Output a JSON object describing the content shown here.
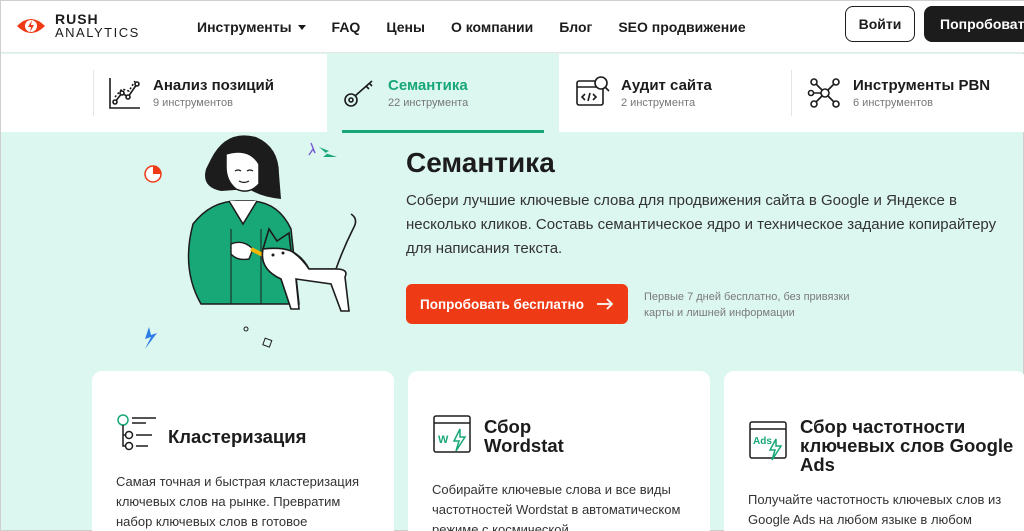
{
  "header": {
    "logo_line1": "RUSH",
    "logo_line2": "ANALYTICS",
    "nav": [
      {
        "label": "Инструменты",
        "has_dropdown": true
      },
      {
        "label": "FAQ"
      },
      {
        "label": "Цены"
      },
      {
        "label": "О компании"
      },
      {
        "label": "Блог"
      },
      {
        "label": "SEO продвижение"
      }
    ],
    "login_label": "Войти",
    "try_label": "Попробовать"
  },
  "tabs": [
    {
      "title": "Анализ позиций",
      "subtitle": "9 инструментов",
      "icon": "chart-line-icon",
      "active": false
    },
    {
      "title": "Семантика",
      "subtitle": "22 инструмента",
      "icon": "key-icon",
      "active": true
    },
    {
      "title": "Аудит сайта",
      "subtitle": "2 инструмента",
      "icon": "site-audit-icon",
      "active": false
    },
    {
      "title": "Инструменты PBN",
      "subtitle": "6 инструментов",
      "icon": "network-icon",
      "active": false
    }
  ],
  "hero": {
    "title": "Семантика",
    "description": "Собери лучшие ключевые слова для продвижения сайта в Google и Яндексе в несколько кликов. Составь семантическое ядро и техническое задание копирайтеру для написания текста.",
    "cta_label": "Попробовать бесплатно",
    "note": "Первые 7 дней бесплатно, без привязки карты и лишней информации"
  },
  "cards": [
    {
      "title": "Кластеризация",
      "icon": "clustering-icon",
      "description": "Самая точная и быстрая кластеризация ключевых слов на рынке. Превратим набор ключевых слов в готовое семантическое"
    },
    {
      "title": "Сбор Wordstat",
      "icon": "wordstat-icon",
      "description": "Собирайте ключевые слова и все виды частотностей Wordstat в автоматическом режиме с космической"
    },
    {
      "title": "Сбор частотности ключевых слов Google Ads",
      "icon": "google-ads-icon",
      "description": "Получайте частотность ключевых слов из Google Ads на любом языке в любом"
    }
  ],
  "colors": {
    "accent_green": "#18a777",
    "mint_bg": "#dcf7ef",
    "cta_red": "#ee3b16",
    "dark": "#1c1c1c"
  }
}
